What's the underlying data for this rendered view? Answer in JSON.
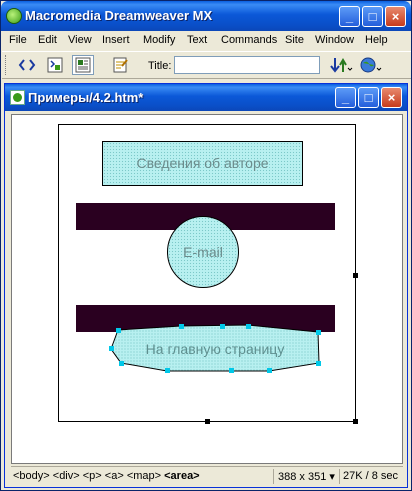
{
  "app": {
    "title": "Macromedia Dreamweaver MX",
    "caption_buttons": {
      "minimize": "_",
      "maximize": "□",
      "close": "×"
    }
  },
  "menu": [
    "File",
    "Edit",
    "View",
    "Insert",
    "Modify",
    "Text",
    "Commands",
    "Site",
    "Window",
    "Help"
  ],
  "toolbar": {
    "buttons": [
      "code-view-icon",
      "split-view-icon",
      "design-view-icon",
      "page-properties-icon"
    ],
    "title_label": "Title:",
    "title_value": "",
    "right_icons": [
      "file-management-icon",
      "preview-in-browser-icon"
    ]
  },
  "document": {
    "title": "Примеры/4.2.htm*",
    "regions": {
      "author": "Сведения об авторе",
      "email": "E-mail",
      "home": "На главную страницу"
    },
    "colors": {
      "hotspot": "#b8f0f0",
      "bar": "#2a0020",
      "handle": "#00c8e8"
    }
  },
  "statusbar": {
    "tag_path": [
      "<body>",
      "<div>",
      "<p>",
      "<a>",
      "<map>"
    ],
    "current_tag": "<area>",
    "window_size": "388 x 351",
    "file_info": "27K / 8 sec"
  }
}
